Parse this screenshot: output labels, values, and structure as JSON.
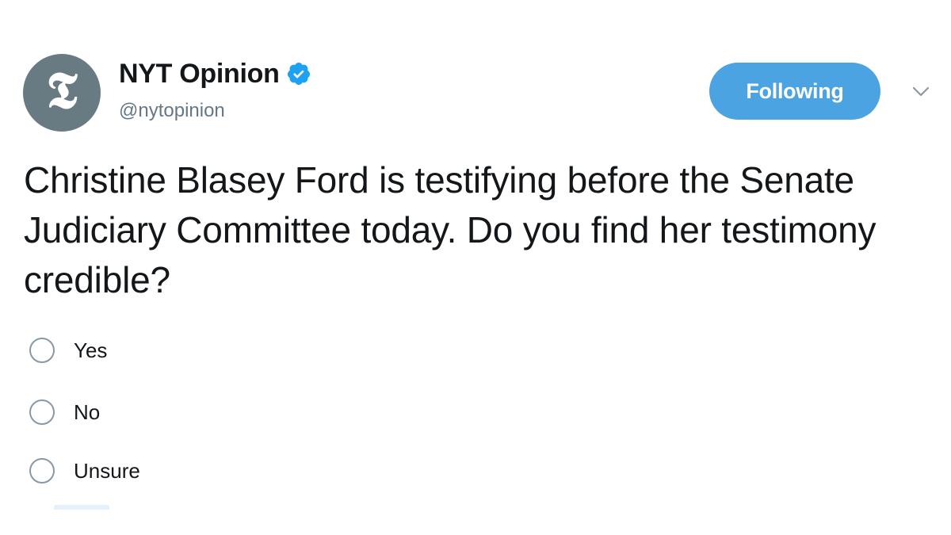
{
  "account": {
    "display_name": "NYT Opinion",
    "handle": "@nytopinion",
    "verified": true,
    "avatar_icon": "nyt-t-logo-icon",
    "avatar_color": "#687a82"
  },
  "follow_button": {
    "label": "Following",
    "color": "#4ba3e2"
  },
  "menu": {
    "icon": "chevron-down-icon"
  },
  "tweet": {
    "text": "Christine Blasey Ford is testifying before the Senate Judiciary Committee today. Do you find her testimony credible?"
  },
  "poll": {
    "options": [
      {
        "label": "Yes"
      },
      {
        "label": "No"
      },
      {
        "label": "Unsure"
      }
    ]
  }
}
